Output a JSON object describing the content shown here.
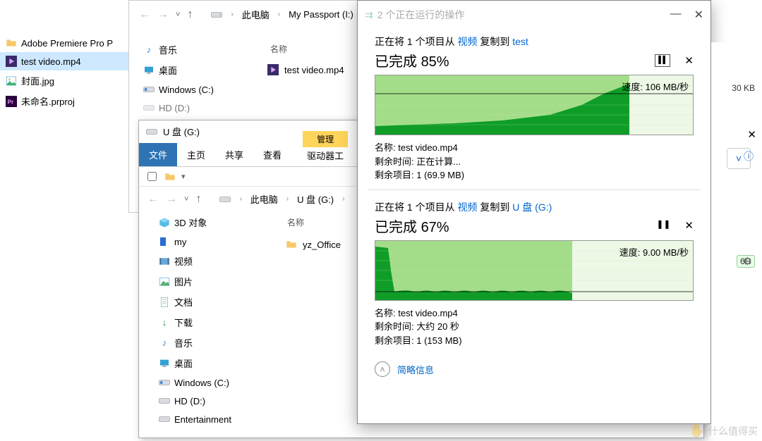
{
  "leftTree": {
    "items": [
      {
        "name": "Adobe Premiere Pro P",
        "icon": "folder",
        "sel": false
      },
      {
        "name": "test video.mp4",
        "icon": "prfile",
        "sel": true
      },
      {
        "name": "封面.jpg",
        "icon": "image",
        "sel": false
      },
      {
        "name": "未命名.prproj",
        "icon": "prproj",
        "sel": false
      }
    ]
  },
  "win1": {
    "crumbs": [
      "此电脑",
      "My Passport (I:)"
    ],
    "side": [
      {
        "label": "音乐",
        "icon": "music"
      },
      {
        "label": "桌面",
        "icon": "desktop"
      },
      {
        "label": "Windows (C:)",
        "icon": "drive"
      },
      {
        "label": "HD (D:)",
        "icon": "drive"
      }
    ],
    "colName": "名称",
    "file": "test video.mp4"
  },
  "win2": {
    "title": "U 盘 (G:)",
    "ribbon": {
      "file": "文件",
      "home": "主页",
      "share": "共享",
      "view": "查看",
      "manage": "管理",
      "toolsTab": "驱动器工"
    },
    "crumbs": [
      "此电脑",
      "U 盘 (G:)"
    ],
    "side": [
      {
        "label": "3D 对象",
        "icon": "3d"
      },
      {
        "label": "my",
        "icon": "folderblue"
      },
      {
        "label": "视频",
        "icon": "videos"
      },
      {
        "label": "图片",
        "icon": "pictures"
      },
      {
        "label": "文档",
        "icon": "documents"
      },
      {
        "label": "下载",
        "icon": "downloads"
      },
      {
        "label": "音乐",
        "icon": "music"
      },
      {
        "label": "桌面",
        "icon": "desktop"
      },
      {
        "label": "Windows (C:)",
        "icon": "drive"
      },
      {
        "label": "HD (D:)",
        "icon": "drive"
      },
      {
        "label": "Entertainment",
        "icon": "drive"
      }
    ],
    "colName": "名称",
    "folder": "yz_Office"
  },
  "dlg": {
    "title": "2 个正在运行的操作",
    "ops": [
      {
        "linePrefix": "正在将 1 个项目从 ",
        "src": "视频",
        "mid": " 复制到 ",
        "dst": "test",
        "doneLabel": "已完成 ",
        "pct": "85%",
        "speed": "速度: 106 MB/秒",
        "name": "名称: test video.mp4",
        "remainTime": "剩余时间: 正在计算...",
        "remainItems": "剩余项目: 1 (69.9 MB)",
        "fillPct": 80,
        "darkTop": 68
      },
      {
        "linePrefix": "正在将 1 个项目从 ",
        "src": "视频",
        "mid": " 复制到 ",
        "dst": "U 盘 (G:)",
        "doneLabel": "已完成 ",
        "pct": "67%",
        "speed": "速度: 9.00 MB/秒",
        "name": "名称: test video.mp4",
        "remainTime": "剩余时间: 大约 20 秒",
        "remainItems": "剩余项目: 1 (153 MB)",
        "fillPct": 62,
        "darkTop": 80
      }
    ],
    "lessInfo": "简略信息"
  },
  "right": {
    "size": "30 KB",
    "chip": "6G"
  },
  "watermark": "什么值得买",
  "glyph": {
    "back": "←",
    "fwd": "→",
    "up": "↑",
    "down": "˅",
    "caret": "›",
    "pause": "❚❚",
    "close": "✕",
    "chevUp": "˄",
    "gear": "⚙",
    "help": "?",
    "sep": "›"
  }
}
